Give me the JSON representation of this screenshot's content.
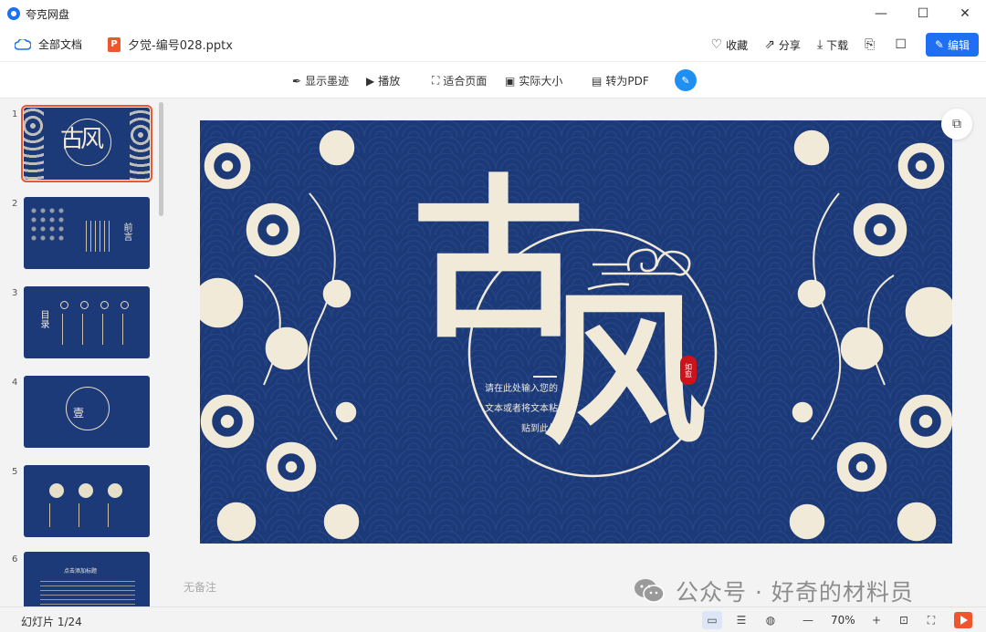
{
  "app": {
    "title": "夸克网盘"
  },
  "window": {
    "minimize": "—",
    "maximize": "☐",
    "close": "✕"
  },
  "toolbar": {
    "all_docs": "全部文档",
    "file_icon": "P",
    "file_name": "夕觉-编号028.pptx",
    "favorite": "收藏",
    "share": "分享",
    "download": "下载",
    "edit": "编辑"
  },
  "viewbar": {
    "ink": "显示墨迹",
    "play": "播放",
    "fit_page": "适合页面",
    "actual_size": "实际大小",
    "to_pdf": "转为PDF"
  },
  "thumbnails": [
    {
      "num": "1",
      "text": "古风"
    },
    {
      "num": "2",
      "text": "前言"
    },
    {
      "num": "3",
      "text": "目录"
    },
    {
      "num": "4",
      "text": "壹"
    },
    {
      "num": "5",
      "text": ""
    },
    {
      "num": "6",
      "text": "点击添加标题"
    }
  ],
  "slide": {
    "title_char1": "古",
    "title_char2": "风",
    "seal_text": "如愈",
    "body_line1": "请在此处输入您的",
    "body_line2": "文本或者将文本粘",
    "body_line3": "贴到此处",
    "bg_color": "#1d3a78",
    "fg_color": "#f2ead9"
  },
  "notes_placeholder": "无备注",
  "watermark": "公众号 · 好奇的材料员",
  "status": {
    "slide_count": "幻灯片 1/24",
    "zoom": "70%",
    "zoom_out": "—",
    "zoom_in": "+"
  }
}
